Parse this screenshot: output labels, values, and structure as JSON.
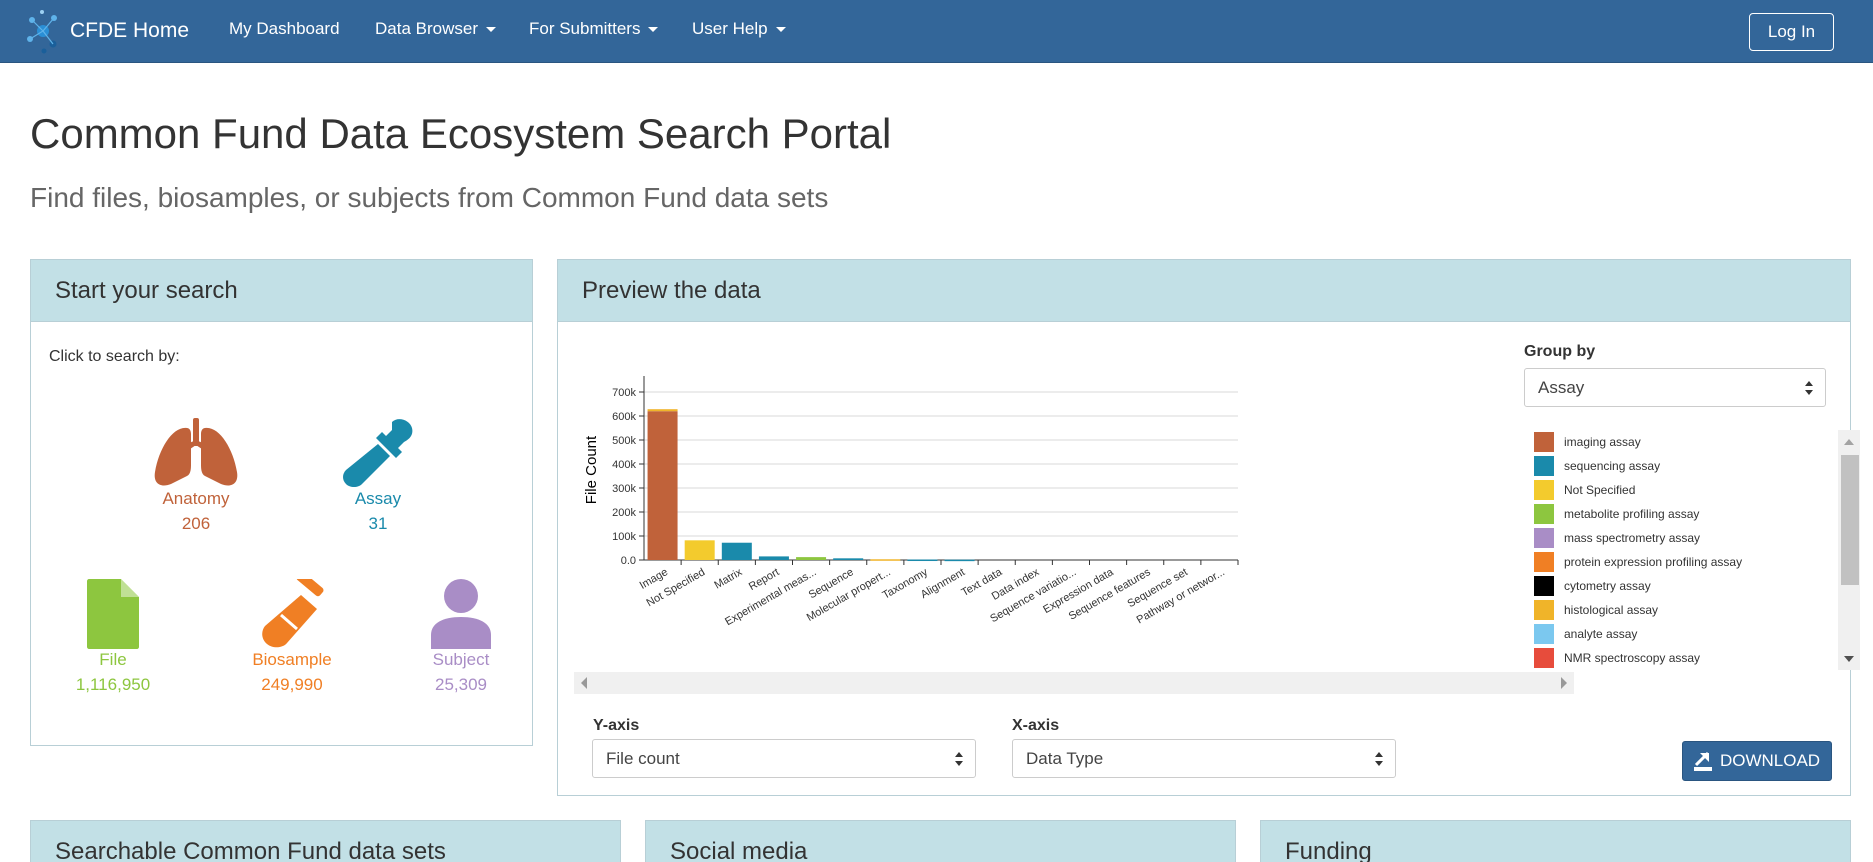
{
  "nav": {
    "brand": "CFDE Home",
    "items": [
      {
        "label": "My Dashboard",
        "dropdown": false
      },
      {
        "label": "Data Browser",
        "dropdown": true
      },
      {
        "label": "For Submitters",
        "dropdown": true
      },
      {
        "label": "User Help",
        "dropdown": true
      }
    ],
    "login": "Log In"
  },
  "page": {
    "title": "Common Fund Data Ecosystem Search Portal",
    "subtitle": "Find files, biosamples, or subjects from Common Fund data sets"
  },
  "search": {
    "heading": "Start your search",
    "intro": "Click to search by:",
    "tiles": [
      {
        "label": "Anatomy",
        "count": "206",
        "color": "#c0623a",
        "icon": "lungs-icon"
      },
      {
        "label": "Assay",
        "count": "31",
        "color": "#1a8aab",
        "icon": "dropper-icon"
      },
      {
        "label": "File",
        "count": "1,116,950",
        "color": "#8dc63f",
        "icon": "file-icon"
      },
      {
        "label": "Biosample",
        "count": "249,990",
        "color": "#f07f24",
        "icon": "test-tube-icon"
      },
      {
        "label": "Subject",
        "count": "25,309",
        "color": "#a98dc6",
        "icon": "person-icon"
      }
    ]
  },
  "preview": {
    "heading": "Preview the data",
    "group_by_label": "Group by",
    "group_by_value": "Assay",
    "y_axis_label": "Y-axis",
    "y_axis_value": "File count",
    "x_axis_label": "X-axis",
    "x_axis_value": "Data Type",
    "download": "DOWNLOAD",
    "legend": [
      {
        "name": "imaging assay",
        "color": "#c0623a"
      },
      {
        "name": "sequencing assay",
        "color": "#1a8aab"
      },
      {
        "name": "Not Specified",
        "color": "#f3cb2d"
      },
      {
        "name": "metabolite profiling assay",
        "color": "#8dc63f"
      },
      {
        "name": "mass spectrometry assay",
        "color": "#a98dc6"
      },
      {
        "name": "protein expression profiling assay",
        "color": "#f07f24"
      },
      {
        "name": "cytometry assay",
        "color": "#000000"
      },
      {
        "name": "histological assay",
        "color": "#f0b429"
      },
      {
        "name": "analyte assay",
        "color": "#7bc8ef"
      },
      {
        "name": "NMR spectroscopy assay",
        "color": "#e74c3c"
      }
    ]
  },
  "chart_data": {
    "type": "bar",
    "ylabel": "File Count",
    "ylim": [
      0,
      750000
    ],
    "yticks": [
      "0.0",
      "100k",
      "200k",
      "300k",
      "400k",
      "500k",
      "600k",
      "700k"
    ],
    "categories": [
      "Image",
      "Not Specified",
      "Matrix",
      "Report",
      "Experimental meas...",
      "Sequence",
      "Molecular propert...",
      "Taxonomy",
      "Alignment",
      "Text data",
      "Data index",
      "Sequence variatio...",
      "Expression data",
      "Sequence features",
      "Sequence set",
      "Pathway or networ..."
    ],
    "values": [
      620000,
      82000,
      72000,
      15000,
      12000,
      7000,
      3000,
      2000,
      1500,
      0,
      0,
      0,
      0,
      0,
      0,
      0
    ],
    "colors": [
      "#c0623a",
      "#f3cb2d",
      "#1a8aab",
      "#1a8aab",
      "#8dc63f",
      "#1a8aab",
      "#f0b429",
      "#1a8aab",
      "#1a8aab",
      "#1a8aab",
      "#1a8aab",
      "#1a8aab",
      "#1a8aab",
      "#1a8aab",
      "#1a8aab",
      "#1a8aab"
    ],
    "grid": true
  },
  "bottom_panels": [
    "Searchable Common Fund data sets",
    "Social media",
    "Funding"
  ]
}
